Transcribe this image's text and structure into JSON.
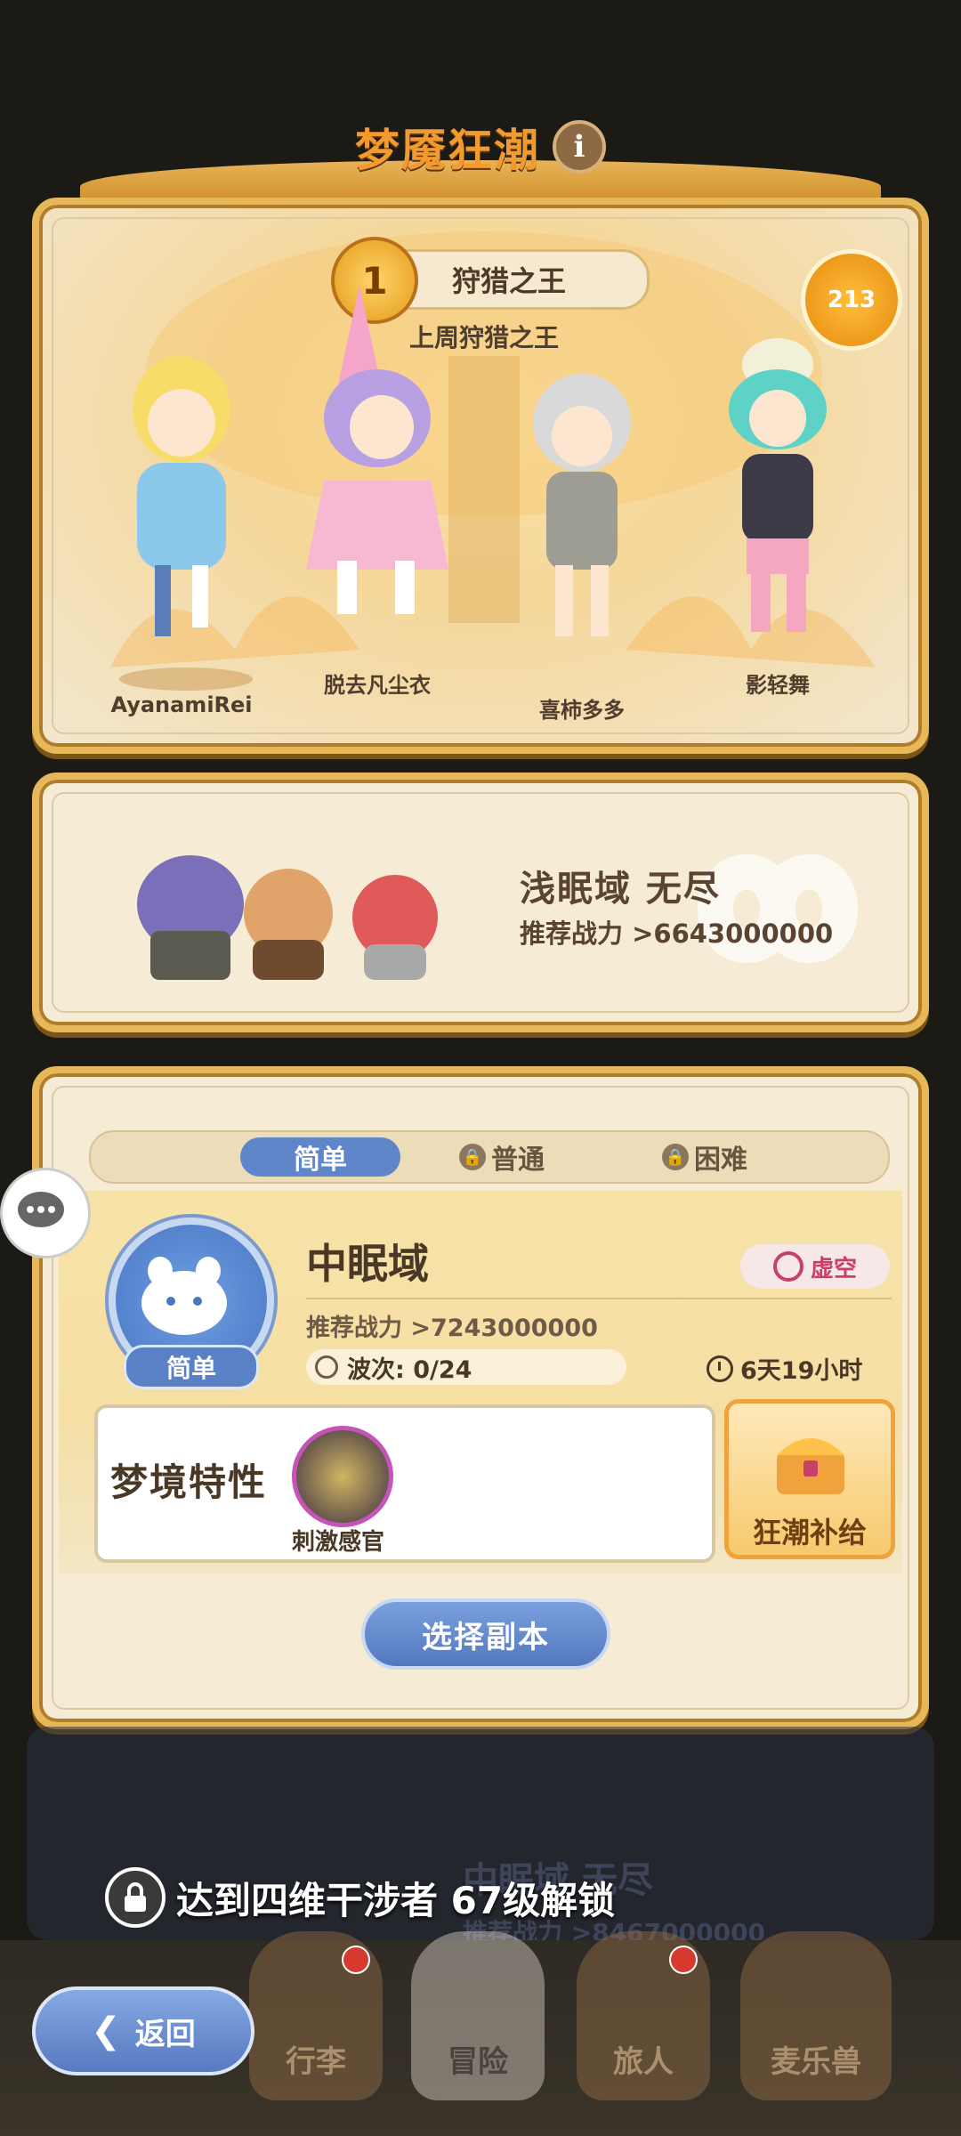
{
  "header": {
    "title": "梦魇狂潮",
    "info_icon": "info-icon"
  },
  "hunt_king": {
    "rank_badge": "1",
    "banner_label": "狩猎之王",
    "subtitle": "上周狩猎之王",
    "podium_badge": "213",
    "characters": [
      {
        "name": "AyanamiRei"
      },
      {
        "name": "脱去凡尘衣"
      },
      {
        "name": "喜柿多多"
      },
      {
        "name": "影轻舞"
      }
    ]
  },
  "endless": {
    "title": "浅眠域  无尽",
    "power_label": "推荐战力  >6643000000"
  },
  "dungeon": {
    "tabs": [
      {
        "label": "简单",
        "active": true,
        "locked": false
      },
      {
        "label": "普通",
        "active": false,
        "locked": true
      },
      {
        "label": "困难",
        "active": false,
        "locked": true
      }
    ],
    "difficulty_badge": "简单",
    "name": "中眠域",
    "element_tag": "虚空",
    "power_label": "推荐战力 >7243000000",
    "wave_label": "波次: 0/24",
    "time_left": "6天19小时",
    "trait_title": "梦境特性",
    "trait_name": "刺激感官",
    "supply_label": "狂潮补给",
    "select_button": "选择副本"
  },
  "locked_mode": {
    "faded_title": "中眠域  无尽",
    "faded_power": "推荐战力 >8467000000",
    "unlock_message": "达到四维干涉者  67级解锁"
  },
  "nav": {
    "back_label": "返回",
    "items": [
      {
        "label": "行李",
        "badge": true
      },
      {
        "label": "冒险",
        "active": true
      },
      {
        "label": "旅人",
        "badge": true
      },
      {
        "label": "麦乐兽"
      }
    ]
  },
  "colors": {
    "accent_orange": "#f29a2e",
    "button_blue": "#5f86c9",
    "card_gold": "#e6b85a",
    "void_pink": "#c6406a"
  }
}
